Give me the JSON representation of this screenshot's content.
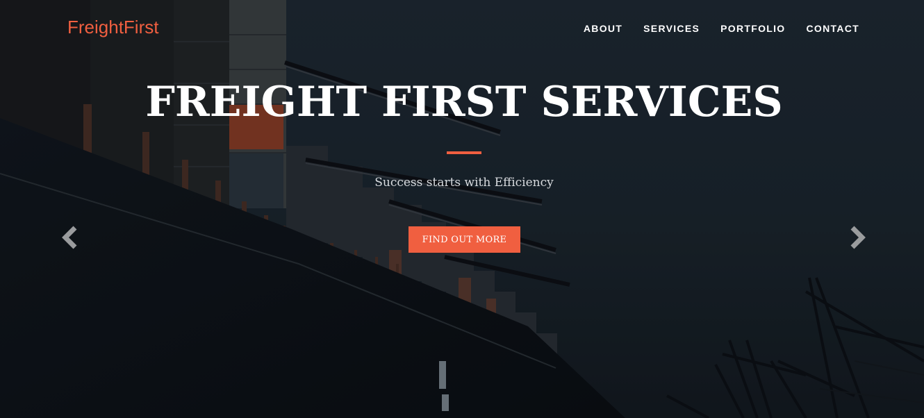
{
  "brand": {
    "name": "FreightFirst",
    "color": "#f05f40"
  },
  "nav": {
    "items": [
      {
        "label": "ABOUT"
      },
      {
        "label": "SERVICES"
      },
      {
        "label": "PORTFOLIO"
      },
      {
        "label": "CONTACT"
      }
    ]
  },
  "hero": {
    "title": "FREIGHT FIRST SERVICES",
    "subtitle": "Success starts with Efficiency",
    "cta_label": "FIND OUT MORE",
    "accent": "#f05f40",
    "background_image": "container-ship-at-port-with-cranes",
    "prev_icon": "chevron-left-icon",
    "next_icon": "chevron-right-icon"
  }
}
